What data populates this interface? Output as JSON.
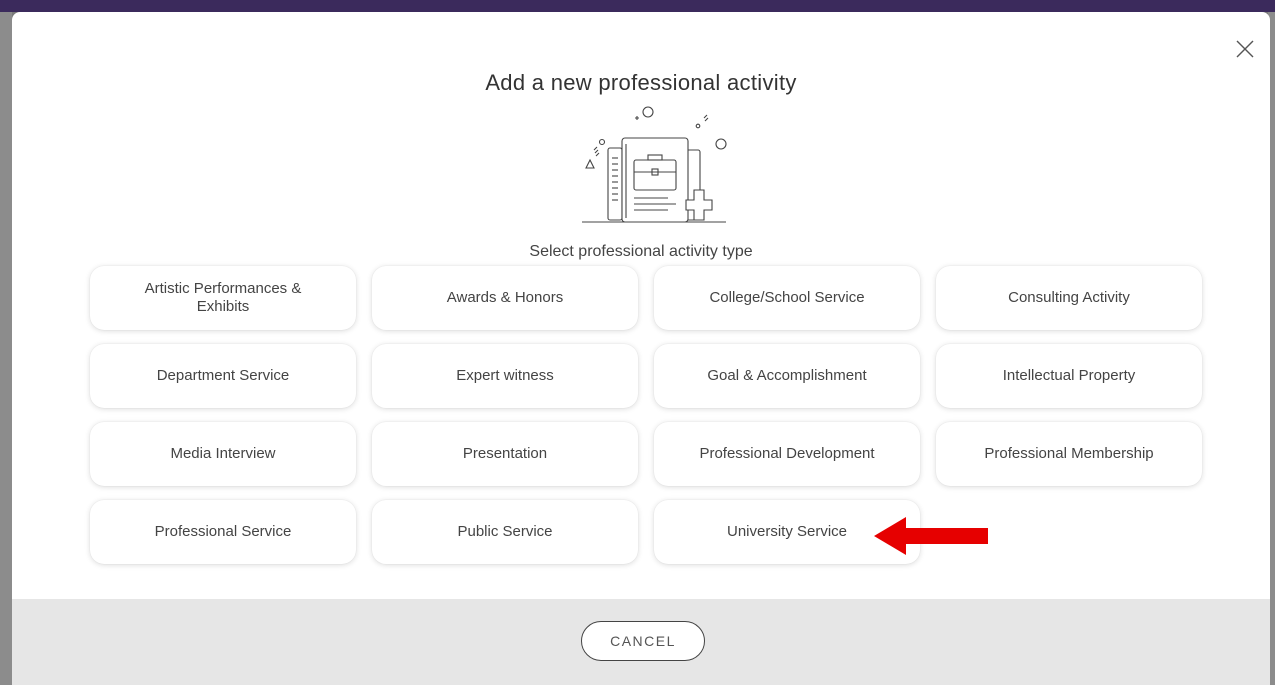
{
  "modal": {
    "title": "Add a new professional activity",
    "subtitle": "Select professional activity type",
    "close_icon": "close-icon",
    "illustration_icon": "briefcase-document-plus-illustration"
  },
  "activity_types": [
    {
      "key": "artistic-performances",
      "label": "Artistic Performances & Exhibits"
    },
    {
      "key": "awards-honors",
      "label": "Awards & Honors"
    },
    {
      "key": "college-school-service",
      "label": "College/School Service"
    },
    {
      "key": "consulting-activity",
      "label": "Consulting Activity"
    },
    {
      "key": "department-service",
      "label": "Department Service"
    },
    {
      "key": "expert-witness",
      "label": "Expert witness"
    },
    {
      "key": "goal-accomplishment",
      "label": "Goal & Accomplishment"
    },
    {
      "key": "intellectual-property",
      "label": "Intellectual Property"
    },
    {
      "key": "media-interview",
      "label": "Media Interview"
    },
    {
      "key": "presentation",
      "label": "Presentation"
    },
    {
      "key": "professional-development",
      "label": "Professional Development"
    },
    {
      "key": "professional-membership",
      "label": "Professional Membership"
    },
    {
      "key": "professional-service",
      "label": "Professional Service"
    },
    {
      "key": "public-service",
      "label": "Public Service"
    },
    {
      "key": "university-service",
      "label": "University Service"
    }
  ],
  "footer": {
    "cancel_label": "CANCEL"
  },
  "annotation": {
    "arrow_color": "#e60000",
    "arrow_icon": "red-arrow-left-icon"
  },
  "colors": {
    "topbar": "#3b2a5c",
    "footer": "#e6e6e6"
  }
}
